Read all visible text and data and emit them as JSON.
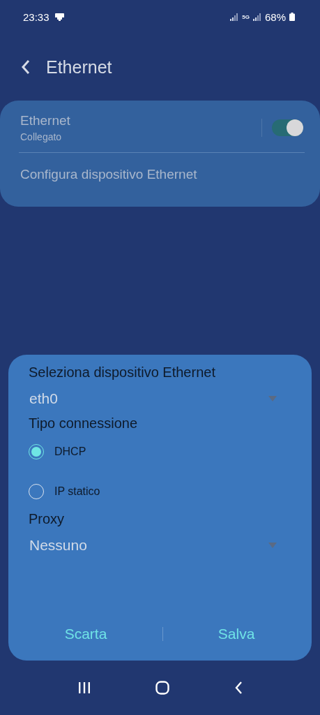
{
  "status_bar": {
    "time": "23:33",
    "network": "5G",
    "battery": "68%"
  },
  "header": {
    "title": "Ethernet"
  },
  "settings_card": {
    "ethernet": {
      "title": "Ethernet",
      "subtitle": "Collegato",
      "on": true
    },
    "configure": "Configura dispositivo Ethernet"
  },
  "dialog": {
    "device_label": "Seleziona dispositivo Ethernet",
    "device_value": "eth0",
    "connection_label": "Tipo connessione",
    "connection_options": [
      {
        "label": "DHCP",
        "selected": true
      },
      {
        "label": "IP statico",
        "selected": false
      }
    ],
    "proxy_label": "Proxy",
    "proxy_value": "Nessuno",
    "buttons": [
      "Scarta",
      "Salva"
    ]
  }
}
